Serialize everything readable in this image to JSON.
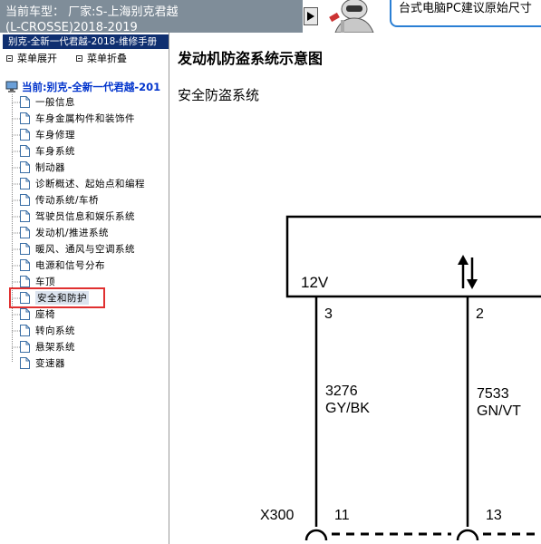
{
  "header": {
    "vehicle_line1": "当前车型： 厂家:S-上海别克君越",
    "vehicle_line2": "(L-CROSSE)2018-2019",
    "hint": "台式电脑PC建议原始尺寸"
  },
  "sidebar": {
    "manual_title": "别克-全新一代君越-2018-维修手册",
    "expand_label": "菜单展开",
    "collapse_label": "菜单折叠",
    "root_label": "当前:别克-全新一代君越-201",
    "items": [
      {
        "label": "一般信息"
      },
      {
        "label": "车身金属构件和装饰件"
      },
      {
        "label": "车身修理"
      },
      {
        "label": "车身系统"
      },
      {
        "label": "制动器"
      },
      {
        "label": "诊断概述、起始点和编程"
      },
      {
        "label": "传动系统/车桥"
      },
      {
        "label": "驾驶员信息和娱乐系统"
      },
      {
        "label": "发动机/推进系统"
      },
      {
        "label": "暖风、通风与空调系统"
      },
      {
        "label": "电源和信号分布"
      },
      {
        "label": "车顶"
      },
      {
        "label": "安全和防护",
        "selected": true
      },
      {
        "label": "座椅"
      },
      {
        "label": "转向系统"
      },
      {
        "label": "悬架系统"
      },
      {
        "label": "变速器"
      }
    ]
  },
  "main": {
    "page_title": "发动机防盗系统示意图",
    "section_title": "安全防盗系统"
  },
  "diagram": {
    "module_pin1_label": "12V",
    "pin1": "3",
    "pin2": "2",
    "wire1_id": "3276",
    "wire1_color": "GY/BK",
    "wire2_id": "7533",
    "wire2_color": "GN/VT",
    "connector": "X300",
    "conn_pin1": "11",
    "conn_pin2": "13"
  },
  "colors": {
    "header_bg": "#7f8d99",
    "manual_title_bg": "#0f2f70",
    "selection_outline": "#e03030",
    "hint_border": "#2a7fd4"
  }
}
